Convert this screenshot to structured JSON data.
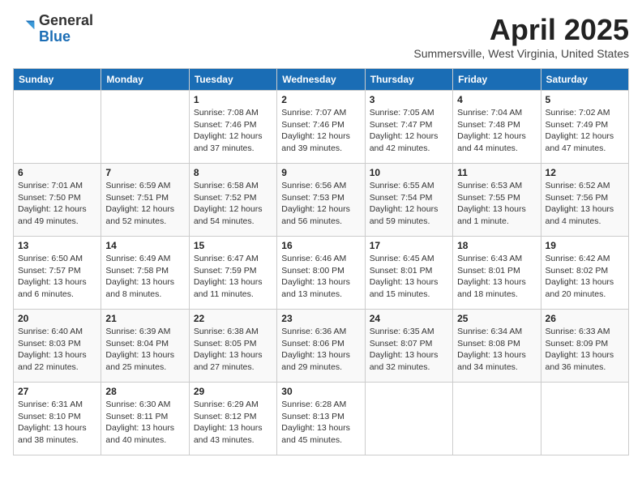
{
  "header": {
    "logo_general": "General",
    "logo_blue": "Blue",
    "month": "April 2025",
    "location": "Summersville, West Virginia, United States"
  },
  "days_of_week": [
    "Sunday",
    "Monday",
    "Tuesday",
    "Wednesday",
    "Thursday",
    "Friday",
    "Saturday"
  ],
  "weeks": [
    [
      {
        "day": "",
        "info": ""
      },
      {
        "day": "",
        "info": ""
      },
      {
        "day": "1",
        "info": "Sunrise: 7:08 AM\nSunset: 7:46 PM\nDaylight: 12 hours and 37 minutes."
      },
      {
        "day": "2",
        "info": "Sunrise: 7:07 AM\nSunset: 7:46 PM\nDaylight: 12 hours and 39 minutes."
      },
      {
        "day": "3",
        "info": "Sunrise: 7:05 AM\nSunset: 7:47 PM\nDaylight: 12 hours and 42 minutes."
      },
      {
        "day": "4",
        "info": "Sunrise: 7:04 AM\nSunset: 7:48 PM\nDaylight: 12 hours and 44 minutes."
      },
      {
        "day": "5",
        "info": "Sunrise: 7:02 AM\nSunset: 7:49 PM\nDaylight: 12 hours and 47 minutes."
      }
    ],
    [
      {
        "day": "6",
        "info": "Sunrise: 7:01 AM\nSunset: 7:50 PM\nDaylight: 12 hours and 49 minutes."
      },
      {
        "day": "7",
        "info": "Sunrise: 6:59 AM\nSunset: 7:51 PM\nDaylight: 12 hours and 52 minutes."
      },
      {
        "day": "8",
        "info": "Sunrise: 6:58 AM\nSunset: 7:52 PM\nDaylight: 12 hours and 54 minutes."
      },
      {
        "day": "9",
        "info": "Sunrise: 6:56 AM\nSunset: 7:53 PM\nDaylight: 12 hours and 56 minutes."
      },
      {
        "day": "10",
        "info": "Sunrise: 6:55 AM\nSunset: 7:54 PM\nDaylight: 12 hours and 59 minutes."
      },
      {
        "day": "11",
        "info": "Sunrise: 6:53 AM\nSunset: 7:55 PM\nDaylight: 13 hours and 1 minute."
      },
      {
        "day": "12",
        "info": "Sunrise: 6:52 AM\nSunset: 7:56 PM\nDaylight: 13 hours and 4 minutes."
      }
    ],
    [
      {
        "day": "13",
        "info": "Sunrise: 6:50 AM\nSunset: 7:57 PM\nDaylight: 13 hours and 6 minutes."
      },
      {
        "day": "14",
        "info": "Sunrise: 6:49 AM\nSunset: 7:58 PM\nDaylight: 13 hours and 8 minutes."
      },
      {
        "day": "15",
        "info": "Sunrise: 6:47 AM\nSunset: 7:59 PM\nDaylight: 13 hours and 11 minutes."
      },
      {
        "day": "16",
        "info": "Sunrise: 6:46 AM\nSunset: 8:00 PM\nDaylight: 13 hours and 13 minutes."
      },
      {
        "day": "17",
        "info": "Sunrise: 6:45 AM\nSunset: 8:01 PM\nDaylight: 13 hours and 15 minutes."
      },
      {
        "day": "18",
        "info": "Sunrise: 6:43 AM\nSunset: 8:01 PM\nDaylight: 13 hours and 18 minutes."
      },
      {
        "day": "19",
        "info": "Sunrise: 6:42 AM\nSunset: 8:02 PM\nDaylight: 13 hours and 20 minutes."
      }
    ],
    [
      {
        "day": "20",
        "info": "Sunrise: 6:40 AM\nSunset: 8:03 PM\nDaylight: 13 hours and 22 minutes."
      },
      {
        "day": "21",
        "info": "Sunrise: 6:39 AM\nSunset: 8:04 PM\nDaylight: 13 hours and 25 minutes."
      },
      {
        "day": "22",
        "info": "Sunrise: 6:38 AM\nSunset: 8:05 PM\nDaylight: 13 hours and 27 minutes."
      },
      {
        "day": "23",
        "info": "Sunrise: 6:36 AM\nSunset: 8:06 PM\nDaylight: 13 hours and 29 minutes."
      },
      {
        "day": "24",
        "info": "Sunrise: 6:35 AM\nSunset: 8:07 PM\nDaylight: 13 hours and 32 minutes."
      },
      {
        "day": "25",
        "info": "Sunrise: 6:34 AM\nSunset: 8:08 PM\nDaylight: 13 hours and 34 minutes."
      },
      {
        "day": "26",
        "info": "Sunrise: 6:33 AM\nSunset: 8:09 PM\nDaylight: 13 hours and 36 minutes."
      }
    ],
    [
      {
        "day": "27",
        "info": "Sunrise: 6:31 AM\nSunset: 8:10 PM\nDaylight: 13 hours and 38 minutes."
      },
      {
        "day": "28",
        "info": "Sunrise: 6:30 AM\nSunset: 8:11 PM\nDaylight: 13 hours and 40 minutes."
      },
      {
        "day": "29",
        "info": "Sunrise: 6:29 AM\nSunset: 8:12 PM\nDaylight: 13 hours and 43 minutes."
      },
      {
        "day": "30",
        "info": "Sunrise: 6:28 AM\nSunset: 8:13 PM\nDaylight: 13 hours and 45 minutes."
      },
      {
        "day": "",
        "info": ""
      },
      {
        "day": "",
        "info": ""
      },
      {
        "day": "",
        "info": ""
      }
    ]
  ]
}
